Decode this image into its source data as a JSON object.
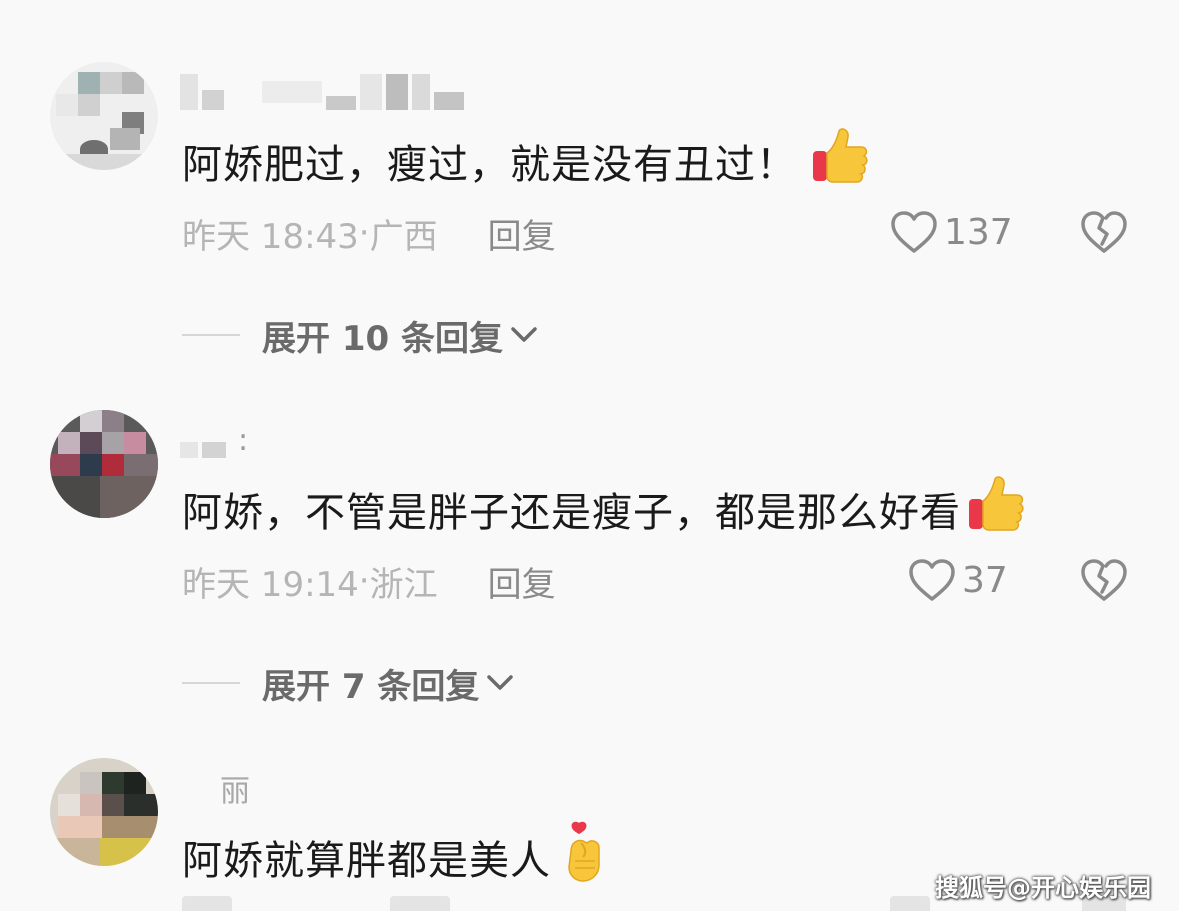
{
  "comments": [
    {
      "text": "阿娇肥过，瘦过，就是没有丑过！",
      "emoji": "thumbs-up",
      "time": "昨天 18:43",
      "location": "广西",
      "reply_label": "回复",
      "likes": "137",
      "expand_label": "展开 10 条回复"
    },
    {
      "username_suffix": ":",
      "text": "阿娇，不管是胖子还是瘦子，都是那么好看",
      "emoji": "thumbs-up",
      "time": "昨天 19:14",
      "location": "浙江",
      "reply_label": "回复",
      "likes": "37",
      "expand_label": "展开 7 条回复"
    },
    {
      "username": "丽",
      "text": "阿娇就算胖都是美人",
      "emoji": "finger-heart"
    }
  ],
  "watermark": "搜狐号@开心娱乐园",
  "colors": {
    "background": "#f9f9f9",
    "text": "#1a1a1a",
    "meta": "#b5b5b5",
    "action": "#8a8a8a",
    "thumb": "#f7c63a",
    "cuff": "#e8384a"
  }
}
